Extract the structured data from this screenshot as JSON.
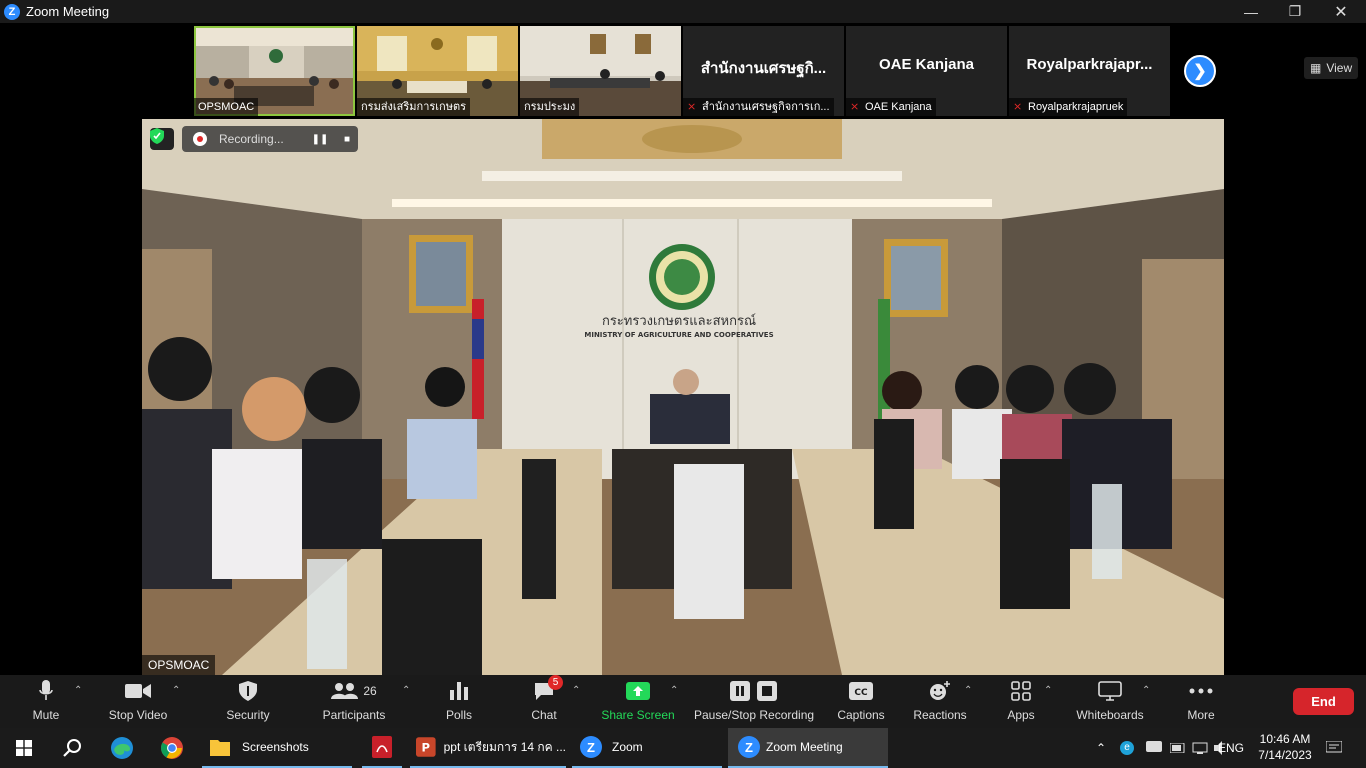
{
  "window": {
    "title": "Zoom Meeting"
  },
  "thumbnails": [
    {
      "name": "OPSMOAC",
      "type": "video",
      "active": true
    },
    {
      "name": "กรมส่งเสริมการเกษตร",
      "type": "video"
    },
    {
      "name": "กรมประมง",
      "type": "video"
    },
    {
      "display": "สำนักงานเศรษฐกิ...",
      "name": "สำนักงานเศรษฐกิจการเก...",
      "type": "name",
      "muted": true
    },
    {
      "display": "OAE Kanjana",
      "name": "OAE Kanjana",
      "type": "name",
      "muted": true
    },
    {
      "display": "Royalparkrajapr...",
      "name": "Royalparkrajapruek",
      "type": "name",
      "muted": true
    }
  ],
  "view_button": "View",
  "main_video": {
    "speaker_name": "OPSMOAC",
    "recording_label": "Recording...",
    "sign_thai": "กระทรวงเกษตรและสหกรณ์",
    "sign_english": "MINISTRY OF AGRICULTURE AND COOPERATIVES"
  },
  "toolbar": {
    "mute": "Mute",
    "stop_video": "Stop Video",
    "security": "Security",
    "participants": "Participants",
    "participants_count": "26",
    "polls": "Polls",
    "chat": "Chat",
    "chat_badge": "5",
    "share_screen": "Share Screen",
    "pause_stop_recording": "Pause/Stop Recording",
    "captions": "Captions",
    "reactions": "Reactions",
    "apps": "Apps",
    "whiteboards": "Whiteboards",
    "more": "More",
    "end": "End"
  },
  "taskbar": {
    "items": [
      {
        "label": "Screenshots",
        "icon": "folder-icon"
      },
      {
        "label": "",
        "icon": "pdf-icon"
      },
      {
        "label": "ppt เตรียมการ 14 กค ...",
        "icon": "powerpoint-icon"
      },
      {
        "label": "Zoom",
        "icon": "zoom-icon"
      },
      {
        "label": "Zoom Meeting",
        "icon": "zoom-icon"
      }
    ],
    "language": "ENG",
    "time": "10:46 AM",
    "date": "7/14/2023"
  },
  "colors": {
    "zoom_blue": "#2d8cff",
    "end_red": "#d6252b",
    "active_green": "#8dc63f",
    "share_green": "#23d959"
  }
}
